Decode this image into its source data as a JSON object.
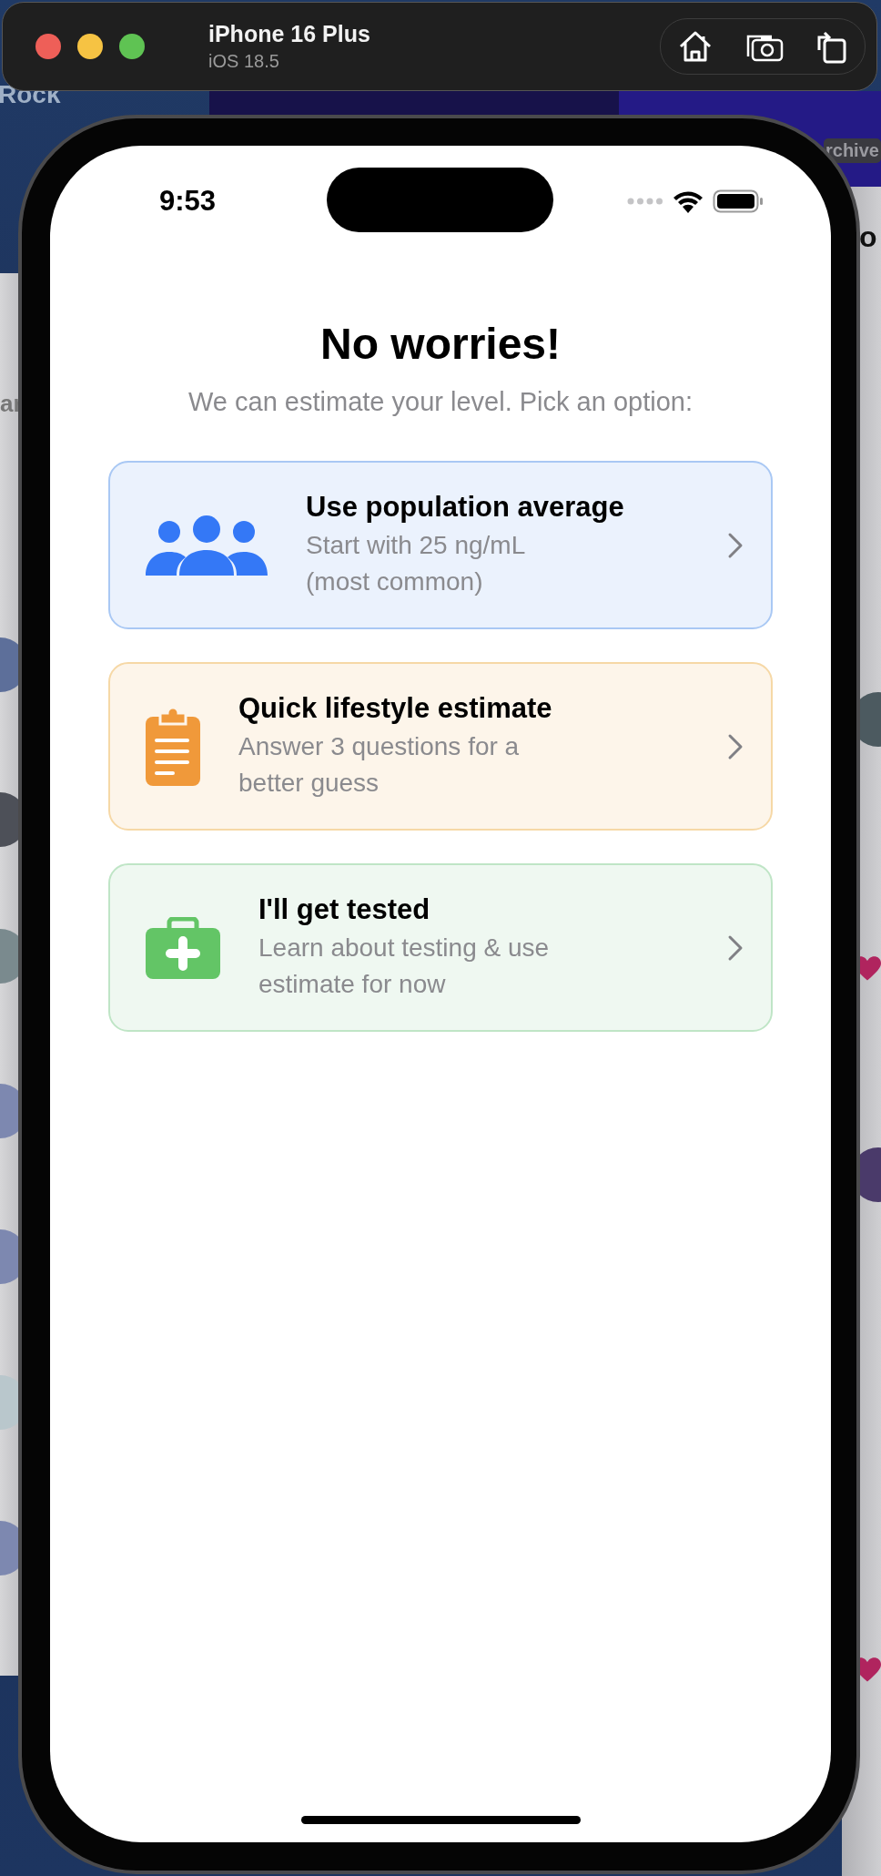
{
  "simulator": {
    "device": "iPhone 16 Plus",
    "os": "iOS 18.5"
  },
  "background": {
    "fragments": [
      "Rock",
      "ar",
      "rchive",
      "o"
    ]
  },
  "status_bar": {
    "time": "9:53"
  },
  "screen": {
    "title": "No worries!",
    "subtitle": "We can estimate your level. Pick an option:",
    "options": [
      {
        "kind": "population",
        "title": "Use population average",
        "detail": "Start with 25 ng/mL\n(most common)"
      },
      {
        "kind": "lifestyle",
        "title": "Quick lifestyle estimate",
        "detail": "Answer 3 questions for a\nbetter guess"
      },
      {
        "kind": "testing",
        "title": "I'll get tested",
        "detail": "Learn about testing & use\nestimate for now"
      }
    ]
  }
}
